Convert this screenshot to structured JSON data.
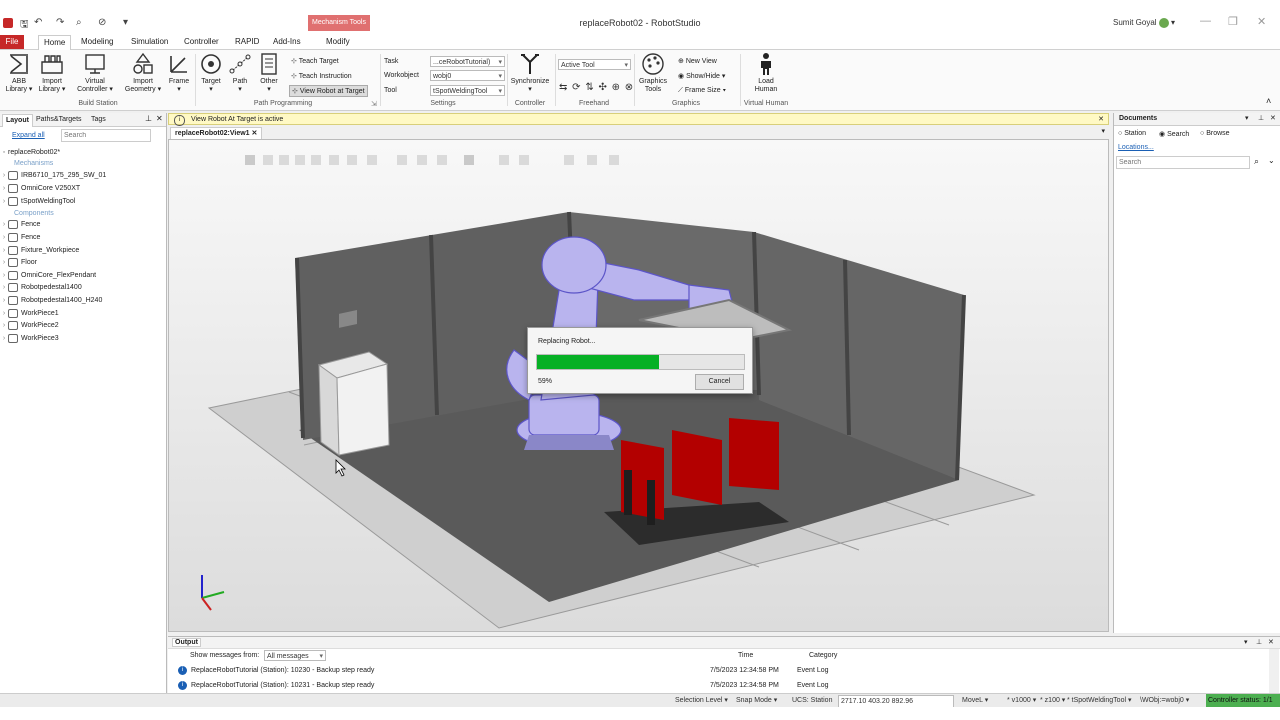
{
  "window": {
    "title": "replaceRobot02 - RobotStudio",
    "user": "Sumit Goyal",
    "context_tab_group": "Mechanism Tools"
  },
  "ribbon_tabs": [
    "File",
    "Home",
    "Modeling",
    "Simulation",
    "Controller",
    "RAPID",
    "Add-Ins",
    "Modify"
  ],
  "ribbon": {
    "build_station": {
      "label": "Build Station",
      "buttons": [
        "ABB Library",
        "Import Library",
        "Virtual Controller",
        "Import Geometry",
        "Frame"
      ]
    },
    "path_programming": {
      "label": "Path Programming",
      "buttons": [
        "Target",
        "Path",
        "Other"
      ],
      "small": [
        "Teach Target",
        "Teach Instruction",
        "View Robot at Target"
      ]
    },
    "settings": {
      "label": "Settings",
      "fields": [
        {
          "label": "Task",
          "value": "...ceRobotTutorial)"
        },
        {
          "label": "Workobject",
          "value": "wobj0"
        },
        {
          "label": "Tool",
          "value": "tSpotWeldingTool"
        }
      ]
    },
    "controller": {
      "label": "Controller",
      "button": "Synchronize"
    },
    "freehand": {
      "label": "Freehand",
      "combo": "Active Tool"
    },
    "graphics": {
      "label": "Graphics",
      "button": "Graphics Tools",
      "small": [
        "New View",
        "Show/Hide",
        "Frame Size"
      ]
    },
    "virtual_human": {
      "label": "Virtual Human",
      "button": "Load Human"
    }
  },
  "left_panel": {
    "tabs": [
      "Layout",
      "Paths&Targets",
      "Tags"
    ],
    "expand_all": "Expand all",
    "search_placeholder": "Search",
    "root": "replaceRobot02*",
    "mechanisms_header": "Mechanisms",
    "mechanisms": [
      "IRB6710_175_295_SW_01",
      "OmniCore V250XT",
      "tSpotWeldingTool"
    ],
    "components_header": "Components",
    "components": [
      "Fence",
      "Fence",
      "Fixture_Workpiece",
      "Floor",
      "OmniCore_FlexPendant",
      "Robotpedestal1400",
      "Robotpedestal1400_H240",
      "WorkPiece1",
      "WorkPiece2",
      "WorkPiece3"
    ]
  },
  "info_bar": {
    "text": "View Robot At Target is active"
  },
  "view_tab": "replaceRobot02:View1",
  "dialog": {
    "title": "Replacing Robot...",
    "progress": 0.59,
    "percent_text": "59%",
    "cancel": "Cancel"
  },
  "documents": {
    "title": "Documents",
    "options": [
      "Station",
      "Search",
      "Browse"
    ],
    "selected": "Search",
    "locations": "Locations...",
    "search_placeholder": "Search"
  },
  "output": {
    "title": "Output",
    "filter_label": "Show messages from:",
    "filter_value": "All messages",
    "columns": [
      "Time",
      "Category"
    ],
    "rows": [
      {
        "message": "ReplaceRobotTutorial (Station): 10230 - Backup step ready",
        "time": "7/5/2023 12:34:58 PM",
        "category": "Event Log"
      },
      {
        "message": "ReplaceRobotTutorial (Station): 10231 - Backup step ready",
        "time": "7/5/2023 12:34:58 PM",
        "category": "Event Log"
      }
    ]
  },
  "status": {
    "selection_level": "Selection Level",
    "snap_mode": "Snap Mode",
    "ucs": "UCS: Station",
    "coords": "2717.10  403.20  892.96",
    "move": "MoveL",
    "speed": "v1000",
    "zone": "z100",
    "tool": "tSpotWeldingTool",
    "wobj": "\\WObj:=wobj0",
    "controller_status": "Controller status: 1/1"
  },
  "colors": {
    "file_tab": "#c62828",
    "progress": "#06b025",
    "controller_status": "#4caf50"
  }
}
